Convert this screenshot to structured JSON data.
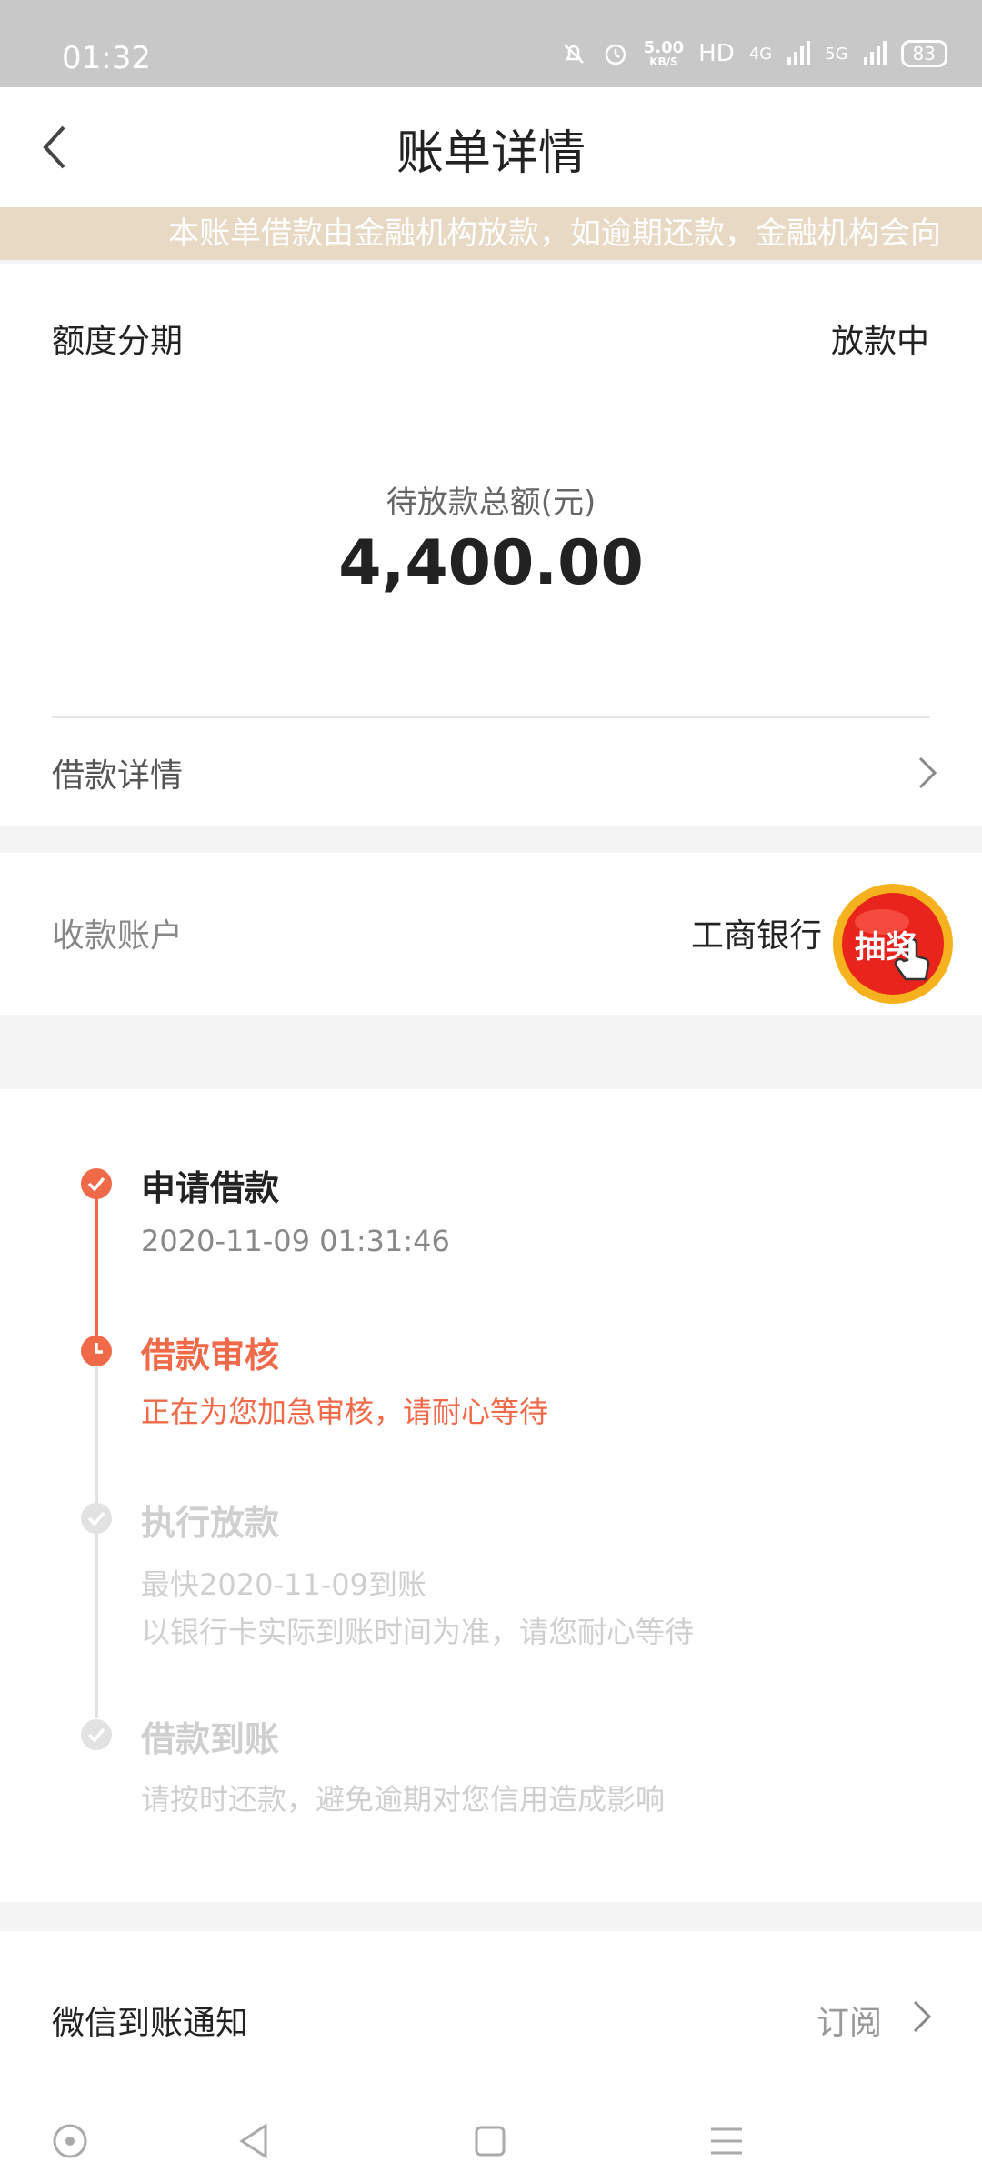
{
  "status_bar": {
    "time": "01:32",
    "speed_value": "5.00",
    "speed_unit": "KB/S",
    "hd_label": "HD",
    "network_4g": "4G",
    "network_5g": "5G",
    "battery": "83"
  },
  "header": {
    "title": "账单详情"
  },
  "notice": {
    "text": "本账单借款由金融机构放款，如逾期还款，金融机构会向"
  },
  "summary": {
    "loan_type": "额度分期",
    "status": "放款中",
    "amount_label": "待放款总额(元)",
    "amount": "4,400.00",
    "detail_label": "借款详情"
  },
  "account": {
    "label": "收款账户",
    "bank": "工商银行",
    "lottery_label": "抽奖"
  },
  "timeline": {
    "steps": [
      {
        "title": "申请借款",
        "lines": [
          "2020-11-09 01:31:46"
        ]
      },
      {
        "title": "借款审核",
        "lines": [
          "正在为您加急审核，请耐心等待"
        ]
      },
      {
        "title": "执行放款",
        "lines": [
          "最快2020-11-09到账",
          "以银行卡实际到账时间为准，请您耐心等待"
        ]
      },
      {
        "title": "借款到账",
        "lines": [
          "请按时还款，避免逾期对您信用造成影响"
        ]
      }
    ]
  },
  "wechat": {
    "label": "微信到账通知",
    "action": "订阅"
  },
  "colors": {
    "accent": "#f06a4a",
    "muted": "#cfcfcf",
    "notice_bg": "#e8d9c5"
  }
}
